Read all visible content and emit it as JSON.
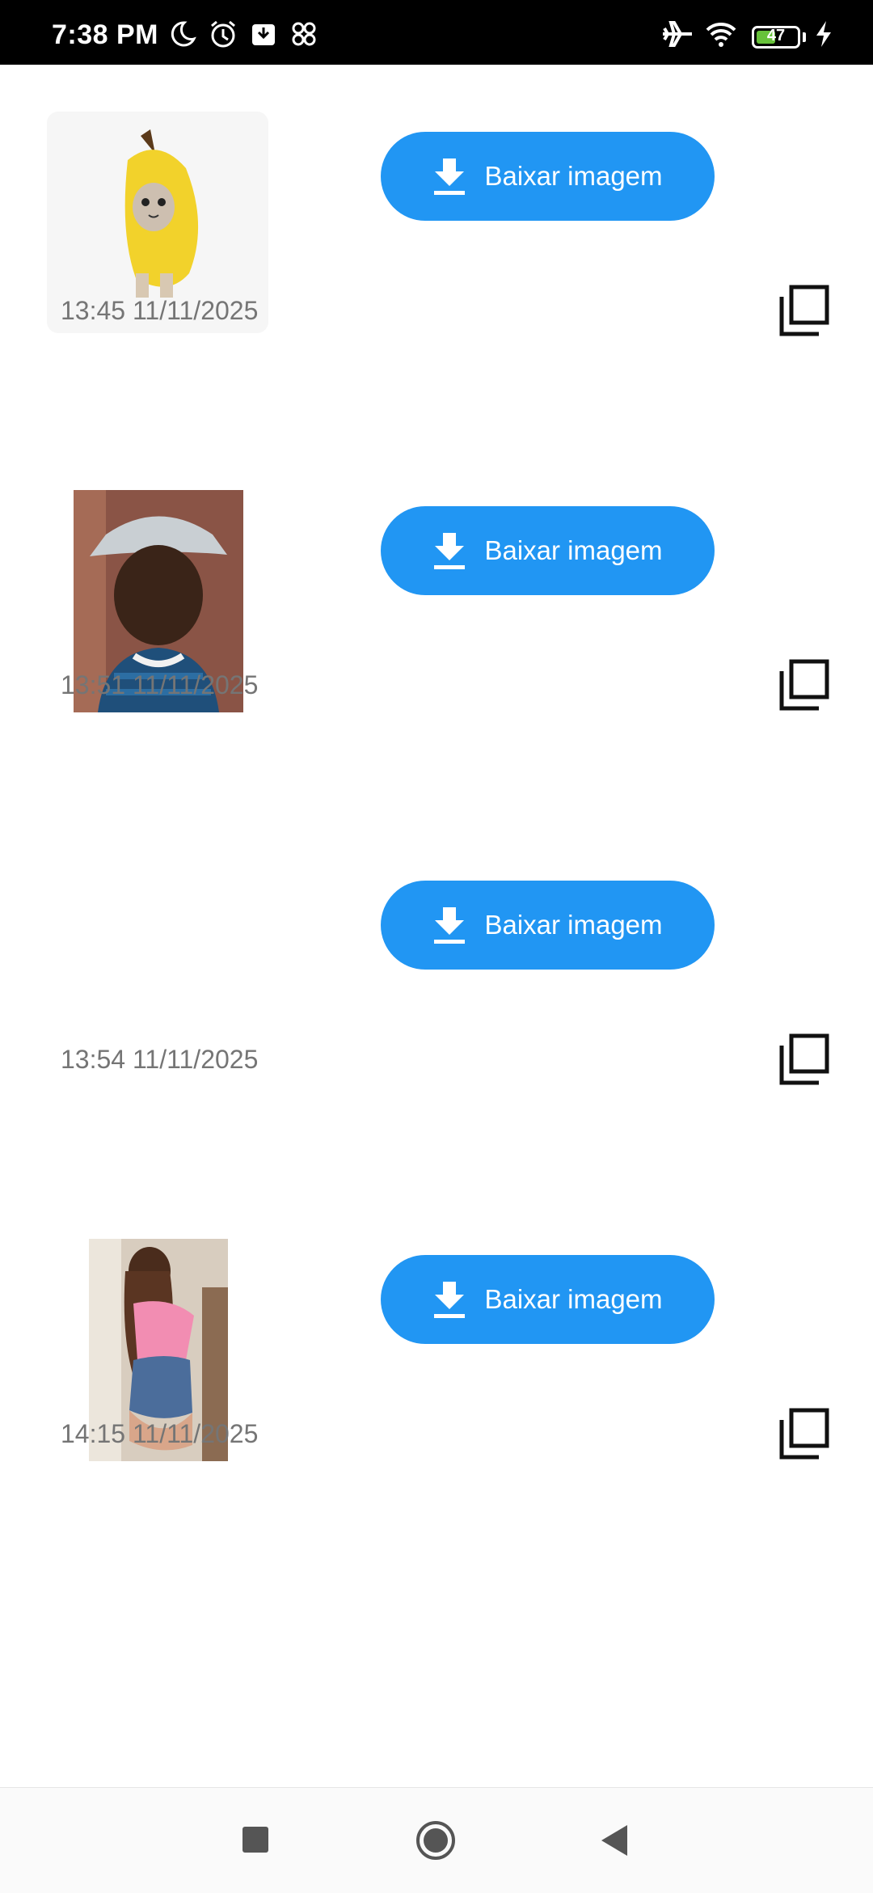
{
  "status_bar": {
    "time": "7:38 PM",
    "battery_level": "47",
    "battery_percent": 47,
    "icons": [
      "moon-icon",
      "alarm-icon",
      "archive-icon",
      "apps-icon",
      "airplane-icon",
      "wifi-icon",
      "battery-icon",
      "charging-icon"
    ]
  },
  "items": [
    {
      "image": "banana-cat-sticker",
      "download_label": "Baixar imagem",
      "timestamp": "13:45 11/11/2025"
    },
    {
      "image": "person-cap-photo",
      "download_label": "Baixar imagem",
      "timestamp": "13:51 11/11/2025"
    },
    {
      "image": "",
      "download_label": "Baixar imagem",
      "timestamp": "13:54 11/11/2025"
    },
    {
      "image": "woman-photo",
      "download_label": "Baixar imagem",
      "timestamp": "14:15 11/11/2025"
    }
  ],
  "nav_bar": {
    "buttons": [
      "recents",
      "home",
      "back"
    ]
  },
  "colors": {
    "accent": "#2196f3",
    "timestamp_text": "#757575",
    "status_bar_bg": "#000000"
  }
}
